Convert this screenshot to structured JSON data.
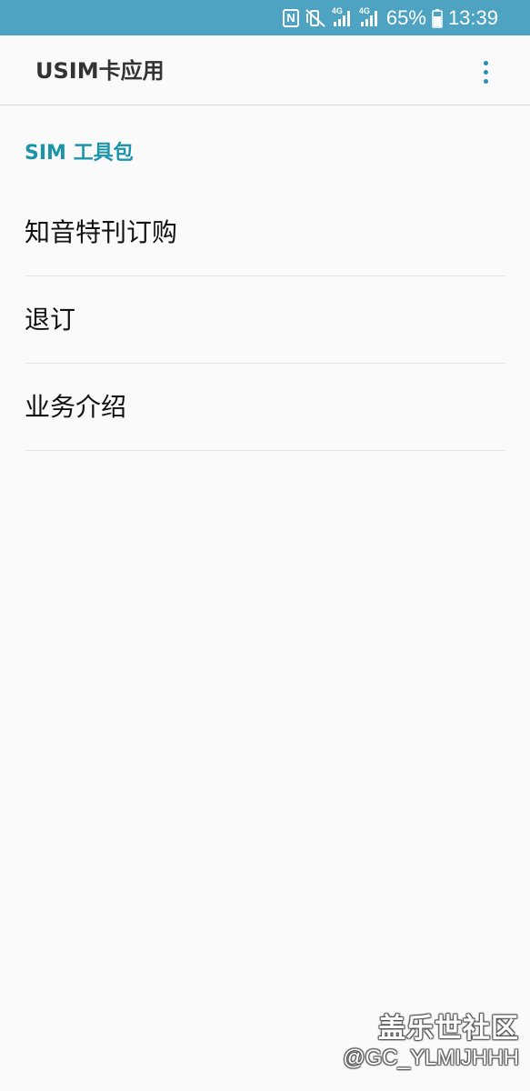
{
  "status_bar": {
    "nfc_icon": "nfc-icon",
    "mute_icon": "vibrate-mute-icon",
    "network_1": "4G",
    "network_2": "4G",
    "battery_percent": "65%",
    "time": "13:39",
    "background_color": "#4da3c1"
  },
  "app_bar": {
    "title": "USIM卡应用",
    "menu_icon": "more-vert-icon"
  },
  "section": {
    "header": "SIM 工具包",
    "accent_color": "#1b94aa"
  },
  "menu_items": [
    {
      "label": "知音特刊订购"
    },
    {
      "label": "退订"
    },
    {
      "label": "业务介绍"
    }
  ],
  "watermark": {
    "title": "盖乐世社区",
    "handle": "@GC_YLMIJHHH"
  }
}
